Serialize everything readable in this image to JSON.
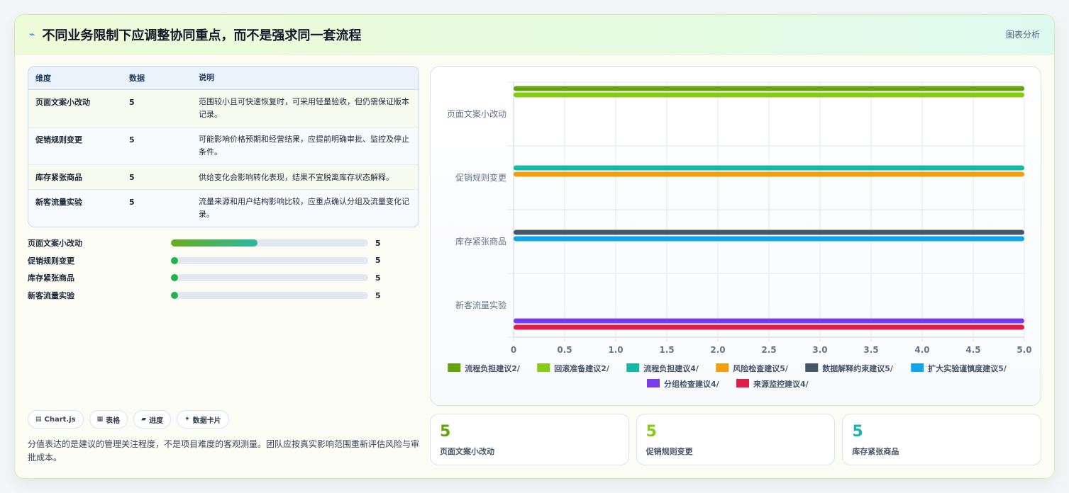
{
  "header": {
    "icon": "lightning-icon",
    "title": "不同业务限制下应调整协同重点，而不是强求同一套流程",
    "tag": "图表分析"
  },
  "table": {
    "headers": [
      "维度",
      "数据",
      "说明"
    ],
    "rows": [
      {
        "dim": "页面文案小改动",
        "value": "5",
        "desc": "范围较小且可快速恢复时，可采用轻量验收，但仍需保证版本记录。"
      },
      {
        "dim": "促销规则变更",
        "value": "5",
        "desc": "可能影响价格预期和经营结果，应提前明确审批、监控及停止条件。"
      },
      {
        "dim": "库存紧张商品",
        "value": "5",
        "desc": "供给变化会影响转化表现，结果不宜脱离库存状态解释。"
      },
      {
        "dim": "新客流量实验",
        "value": "5",
        "desc": "流量来源和用户结构影响比较，应重点确认分组及流量变化记录。"
      }
    ]
  },
  "progress": [
    {
      "label": "页面文案小改动",
      "value": "5",
      "fraction": 0.44
    },
    {
      "label": "促销规则变更",
      "value": "5",
      "fraction": 0
    },
    {
      "label": "库存紧张商品",
      "value": "5",
      "fraction": 0
    },
    {
      "label": "新客流量实验",
      "value": "5",
      "fraction": 0
    }
  ],
  "chips": [
    {
      "icon": "chart-icon",
      "label": "Chart.js"
    },
    {
      "icon": "table-icon",
      "label": "表格"
    },
    {
      "icon": "progress-icon",
      "label": "进度"
    },
    {
      "icon": "sparkle-icon",
      "label": "数据卡片"
    }
  ],
  "note": "分值表达的是建议的管理关注程度，不是项目难度的客观测量。团队应按真实影响范围重新评估风险与审批成本。",
  "stats": [
    {
      "value": "5",
      "label": "页面文案小改动",
      "color": "#65a30d"
    },
    {
      "value": "5",
      "label": "促销规则变更",
      "color": "#84cc16"
    },
    {
      "value": "5",
      "label": "库存紧张商品",
      "color": "#14b8a6"
    }
  ],
  "chart_data": {
    "type": "bar",
    "orientation": "horizontal",
    "categories": [
      "页面文案小改动",
      "促销规则变更",
      "库存紧张商品",
      "新客流量实验"
    ],
    "xlim": [
      0,
      5
    ],
    "xticks": [
      "0",
      "0.5",
      "1.0",
      "1.5",
      "2.0",
      "2.5",
      "3.0",
      "3.5",
      "4.0",
      "4.5",
      "5.0"
    ],
    "grid": true,
    "legend_position": "bottom",
    "series": [
      {
        "name": "流程负担建议2/",
        "color": "#65a30d",
        "values": [
          5,
          null,
          null,
          null
        ]
      },
      {
        "name": "回滚准备建议2/",
        "color": "#84cc16",
        "values": [
          5,
          null,
          null,
          null
        ]
      },
      {
        "name": "流程负担建议4/",
        "color": "#14b8a6",
        "values": [
          null,
          5,
          null,
          null
        ]
      },
      {
        "name": "风险检查建议5/",
        "color": "#f59e0b",
        "values": [
          null,
          5,
          null,
          null
        ]
      },
      {
        "name": "数据解释约束建议5/",
        "color": "#475569",
        "values": [
          null,
          null,
          5,
          null
        ]
      },
      {
        "name": "扩大实验谨慎度建议5/",
        "color": "#0ea5e9",
        "values": [
          null,
          null,
          5,
          null
        ]
      },
      {
        "name": "分组检查建议4/",
        "color": "#7c3aed",
        "values": [
          null,
          null,
          null,
          5
        ]
      },
      {
        "name": "来源监控建议4/",
        "color": "#e11d48",
        "values": [
          null,
          null,
          null,
          5
        ]
      }
    ]
  }
}
